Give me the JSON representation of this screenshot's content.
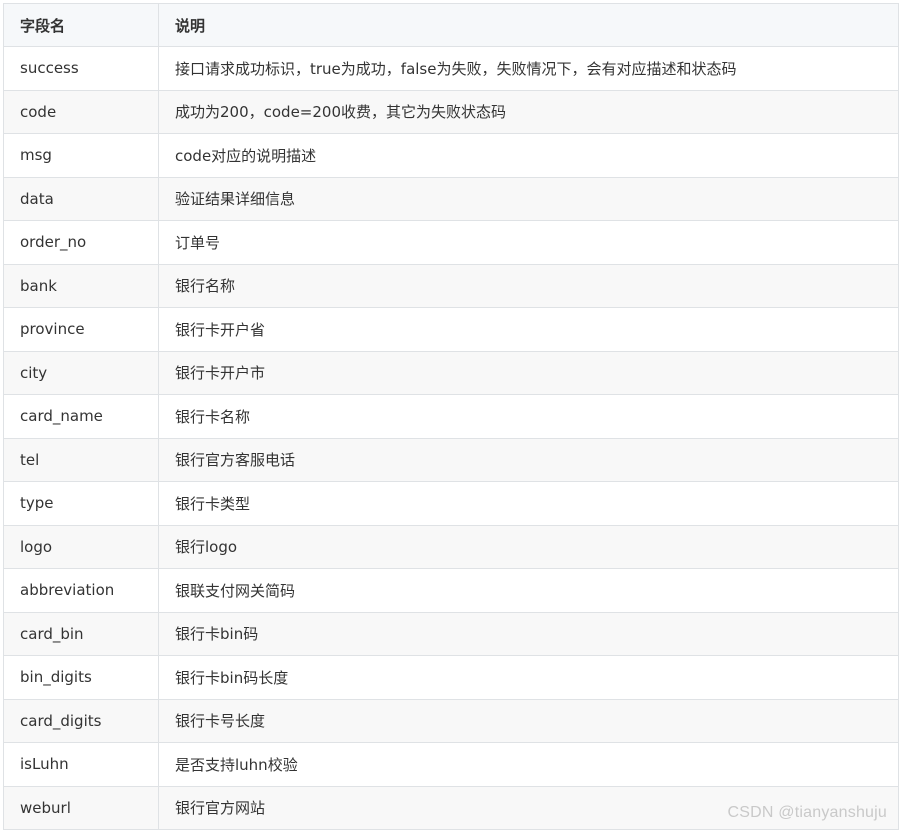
{
  "table": {
    "headers": [
      "字段名",
      "说明"
    ],
    "rows": [
      {
        "field": "success",
        "desc": "接口请求成功标识，true为成功，false为失败，失败情况下，会有对应描述和状态码"
      },
      {
        "field": "code",
        "desc": "成功为200，code=200收费，其它为失败状态码"
      },
      {
        "field": "msg",
        "desc": "code对应的说明描述"
      },
      {
        "field": "data",
        "desc": "验证结果详细信息"
      },
      {
        "field": "order_no",
        "desc": "订单号"
      },
      {
        "field": "bank",
        "desc": "银行名称"
      },
      {
        "field": "province",
        "desc": "银行卡开户省"
      },
      {
        "field": "city",
        "desc": "银行卡开户市"
      },
      {
        "field": "card_name",
        "desc": "银行卡名称"
      },
      {
        "field": "tel",
        "desc": "银行官方客服电话"
      },
      {
        "field": "type",
        "desc": "银行卡类型"
      },
      {
        "field": "logo",
        "desc": "银行logo"
      },
      {
        "field": "abbreviation",
        "desc": "银联支付网关简码"
      },
      {
        "field": "card_bin",
        "desc": "银行卡bin码"
      },
      {
        "field": "bin_digits",
        "desc": "银行卡bin码长度"
      },
      {
        "field": "card_digits",
        "desc": "银行卡号长度"
      },
      {
        "field": "isLuhn",
        "desc": "是否支持luhn校验"
      },
      {
        "field": "weburl",
        "desc": "银行官方网站"
      }
    ]
  },
  "watermark": "CSDN @tianyanshuju"
}
